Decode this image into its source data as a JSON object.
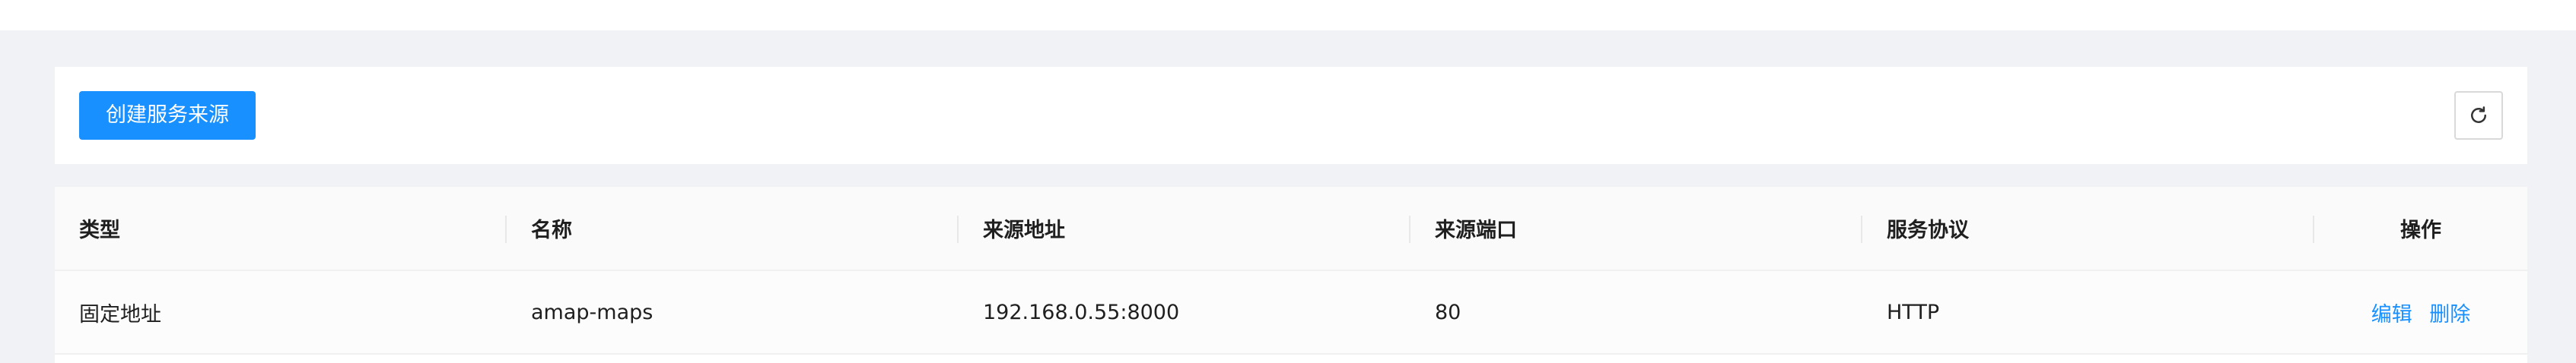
{
  "toolbar": {
    "create_label": "创建服务来源",
    "refresh_icon": "refresh-icon"
  },
  "table": {
    "columns": [
      "类型",
      "名称",
      "来源地址",
      "来源端口",
      "服务协议",
      "操作"
    ],
    "rows": [
      {
        "type": "固定地址",
        "name": "amap-maps",
        "address": "192.168.0.55:8000",
        "port": "80",
        "protocol": "HTTP",
        "actions": [
          "编辑",
          "删除"
        ]
      }
    ]
  },
  "colors": {
    "primary": "#1890ff",
    "background": "#f0f2f5"
  }
}
